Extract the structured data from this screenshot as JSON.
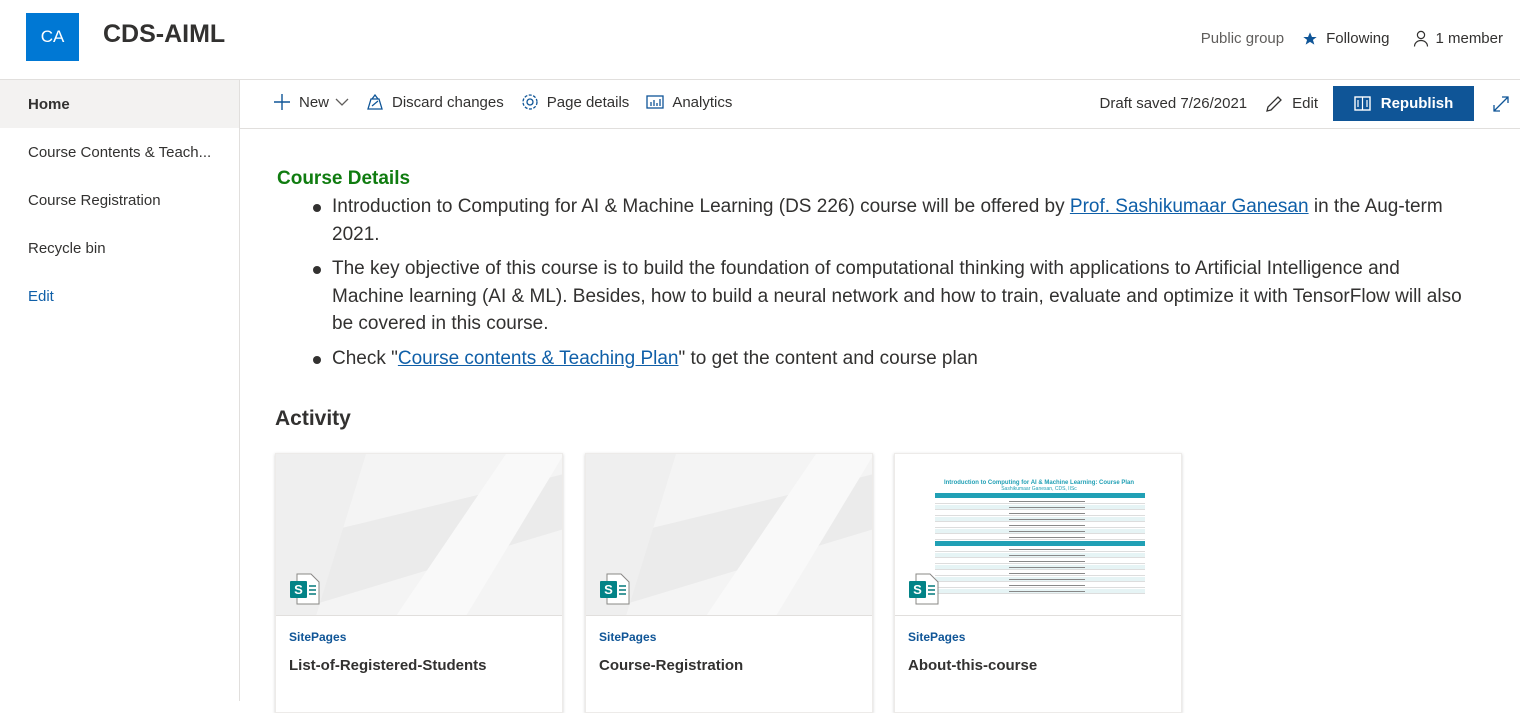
{
  "header": {
    "logo_text": "CA",
    "site_title": "CDS-AIML",
    "group_type": "Public group",
    "follow_label": "Following",
    "members_label": "1 member"
  },
  "nav": {
    "items": [
      {
        "label": "Home"
      },
      {
        "label": "Course Contents & Teach..."
      },
      {
        "label": "Course Registration"
      },
      {
        "label": "Recycle bin"
      }
    ],
    "edit_label": "Edit"
  },
  "commandbar": {
    "new_label": "New",
    "discard_label": "Discard changes",
    "page_details_label": "Page details",
    "analytics_label": "Analytics",
    "draft_status": "Draft saved 7/26/2021",
    "edit_label": "Edit",
    "republish_label": "Republish"
  },
  "content": {
    "heading": "Course Details",
    "bullet1_pre": "Introduction to Computing for AI & Machine Learning (DS 226) course will be offered by ",
    "bullet1_link": "Prof. Sashikumaar Ganesan",
    "bullet1_post": " in the Aug-term 2021.",
    "bullet2": "The key objective of this course is to build the foundation of computational thinking with applications to Artificial Intelligence and Machine learning (AI & ML). Besides, how to build a neural network and how to train, evaluate and optimize it with TensorFlow will also be covered in this course.",
    "bullet3_pre": "Check \"",
    "bullet3_link": "Course contents & Teaching Plan",
    "bullet3_post": "\" to get the content and course plan"
  },
  "activity": {
    "title": "Activity",
    "cards": [
      {
        "type": "SitePages",
        "title": "List-of-Registered-Students"
      },
      {
        "type": "SitePages",
        "title": "Course-Registration"
      },
      {
        "type": "SitePages",
        "title": "About-this-course"
      }
    ],
    "preview": {
      "title": "Introduction to Computing for AI & Machine Learning: Course Plan",
      "subtitle": "Sashikumaar Ganesan, CDS, IISc"
    }
  },
  "colors": {
    "brand": "#0078d4",
    "republish": "#0f5597",
    "heading_green": "#107c10",
    "link": "#0f5fa8"
  },
  "icons": [
    "star-icon",
    "person-icon",
    "plus-icon",
    "chevron-down-icon",
    "discard-icon",
    "gear-icon",
    "analytics-icon",
    "pencil-icon",
    "book-icon",
    "expand-icon",
    "sharepoint-page-icon"
  ]
}
